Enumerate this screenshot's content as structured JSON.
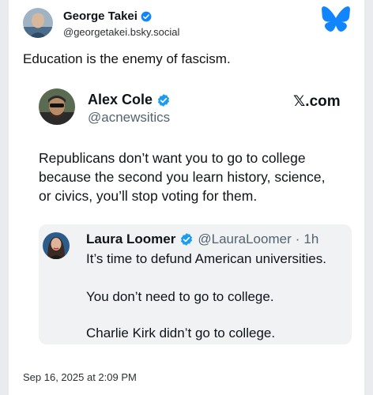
{
  "post": {
    "author_name": "George Takei",
    "author_handle": "@georgetakei.bsky.social",
    "text": "Education is the enemy of fascism.",
    "timestamp": "Sep 16, 2025 at 2:09 PM"
  },
  "embed": {
    "author_name": "Alex Cole",
    "author_handle": "@acnewsitics",
    "source": "𝕏.com",
    "text_lines": [
      "Republicans don’t want you to go to college",
      "because the second you learn history, science,",
      "or civics, you’ll stop voting for them."
    ],
    "quote": {
      "author_name": "Laura Loomer",
      "author_handle": "@LauraLoomer",
      "separator": "·",
      "age": "1h",
      "lines": [
        "It’s time to defund American universities.",
        "You don’t need to go to college.",
        "Charlie Kirk didn’t go to college."
      ]
    }
  },
  "icons": {
    "verified": "verified-badge-icon",
    "bluesky": "bluesky-butterfly-icon"
  },
  "colors": {
    "bluesky_blue": "#1185fe",
    "verified_blue": "#1d9bf0",
    "quote_background": "#f0f2f4",
    "secondary_text": "#536471"
  }
}
